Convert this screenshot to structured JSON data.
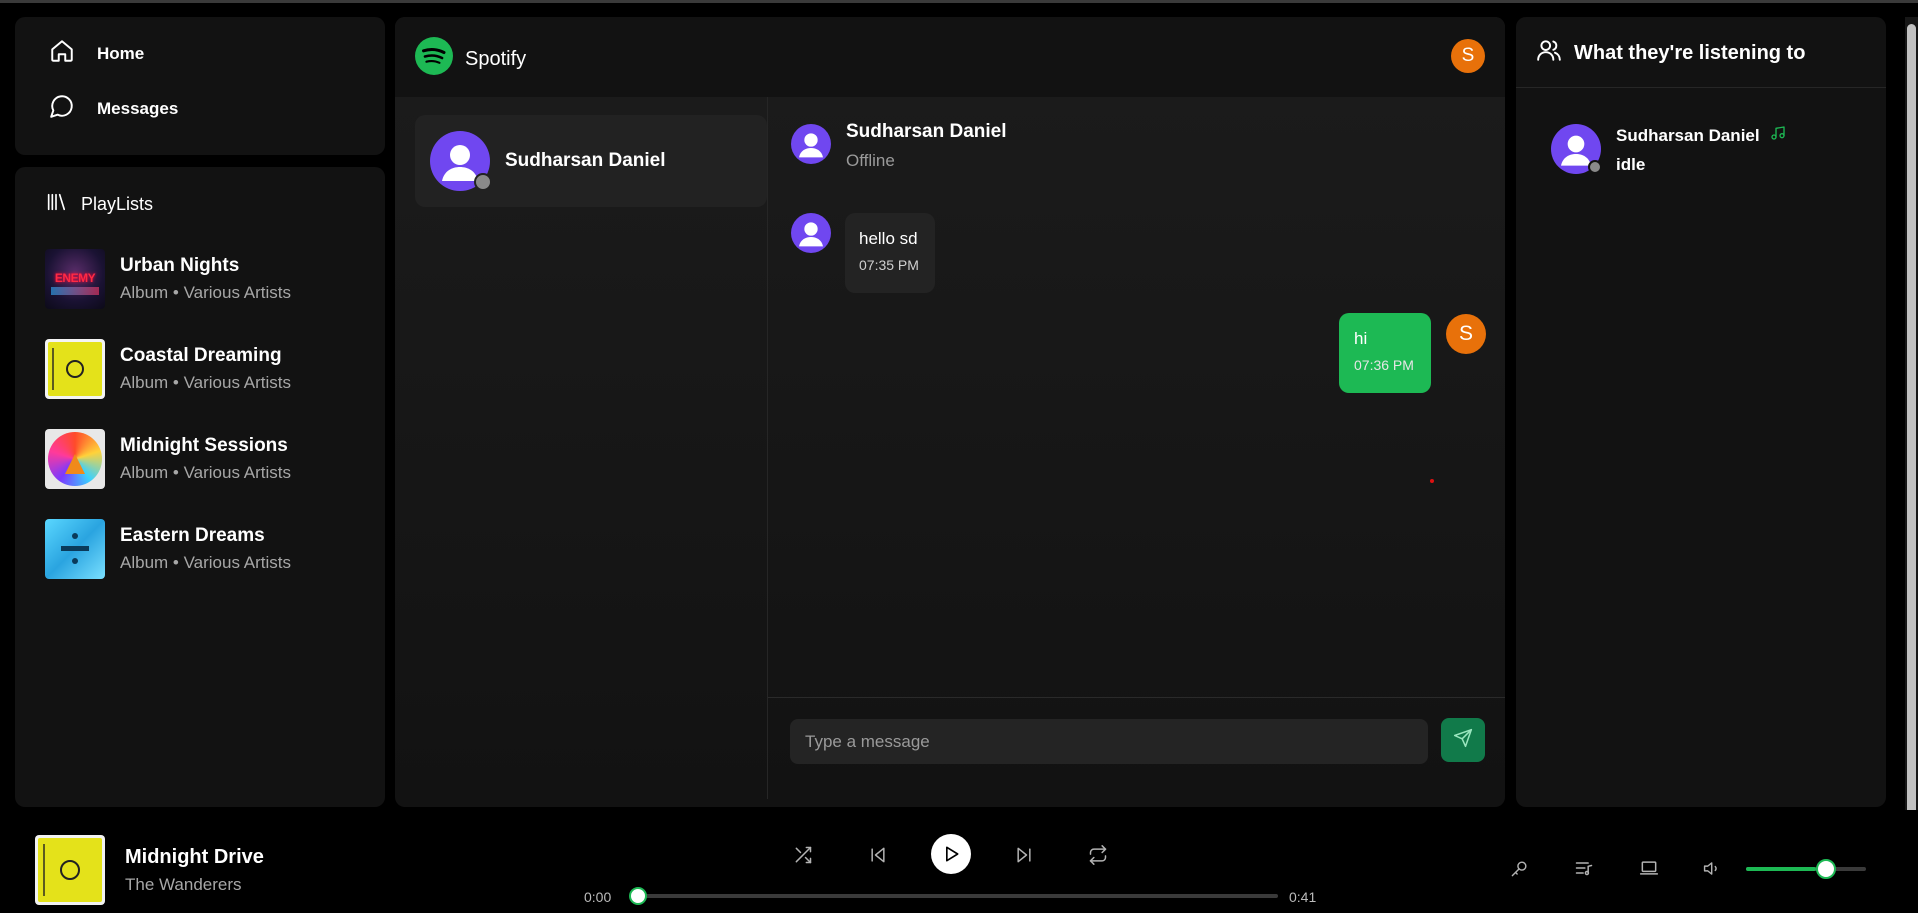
{
  "nav": {
    "items": [
      {
        "label": "Home",
        "icon": "home-icon"
      },
      {
        "label": "Messages",
        "icon": "message-icon"
      }
    ]
  },
  "playlists": {
    "title": "PlayLists",
    "items": [
      {
        "name": "Urban Nights",
        "subtitle": "Album • Various Artists",
        "cover_text": "ENEMY"
      },
      {
        "name": "Coastal Dreaming",
        "subtitle": "Album • Various Artists"
      },
      {
        "name": "Midnight Sessions",
        "subtitle": "Album • Various Artists"
      },
      {
        "name": "Eastern Dreams",
        "subtitle": "Album • Various Artists"
      }
    ]
  },
  "header": {
    "brand": "Spotify",
    "user_initial": "S"
  },
  "conversations": [
    {
      "name": "Sudharsan Daniel",
      "status": "offline"
    }
  ],
  "chat": {
    "contact_name": "Sudharsan Daniel",
    "contact_status": "Offline",
    "messages": [
      {
        "direction": "incoming",
        "text": "hello sd",
        "time": "07:35 PM"
      },
      {
        "direction": "outgoing",
        "text": "hi",
        "time": "07:36 PM",
        "sender_initial": "S"
      }
    ],
    "input_placeholder": "Type a message"
  },
  "listening": {
    "title": "What they're listening to",
    "friends": [
      {
        "name": "Sudharsan Daniel",
        "activity": "idle"
      }
    ]
  },
  "player": {
    "track_title": "Midnight Drive",
    "artist": "The Wanderers",
    "current_time": "0:00",
    "duration": "0:41",
    "progress": 0.0,
    "volume": 0.58
  },
  "colors": {
    "accent": "#1db954",
    "avatar_user": "#e8710a",
    "avatar_contact": "#7047f0"
  }
}
